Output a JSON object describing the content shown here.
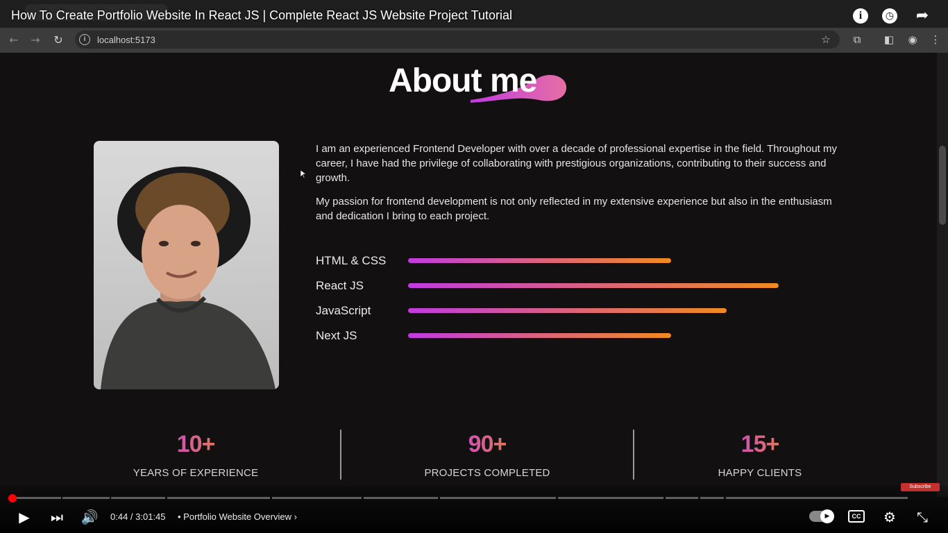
{
  "video": {
    "title": "How To Create Portfolio Website In React JS | Complete React JS Website Project Tutorial",
    "time": "0:44 / 3:01:45",
    "chapter": "• Portfolio Website Overview",
    "progress_fraction": 0.004,
    "subscribe_label": "Subscribe"
  },
  "browser": {
    "url": "localhost:5173"
  },
  "page": {
    "heading": "About me",
    "bio_paragraphs": [
      "I am an experienced Frontend Developer with over a decade of professional expertise in the field. Throughout my career, I have had the privilege of collaborating with prestigious organizations, contributing to their success and growth.",
      "My passion for frontend development is not only reflected in my extensive experience but also in the enthusiasm and dedication I bring to each project."
    ],
    "skills": [
      {
        "name": "HTML & CSS",
        "level": 0.71
      },
      {
        "name": "React JS",
        "level": 1.0
      },
      {
        "name": "JavaScript",
        "level": 0.86
      },
      {
        "name": "Next JS",
        "level": 0.71
      }
    ],
    "stats": [
      {
        "value": "10+",
        "label": "YEARS OF EXPERIENCE"
      },
      {
        "value": "90+",
        "label": "PROJECTS COMPLETED"
      },
      {
        "value": "15+",
        "label": "HAPPY CLIENTS"
      }
    ]
  },
  "icons": {
    "back": "arrow-left-icon",
    "forward": "arrow-right-icon",
    "reload": "reload-icon",
    "star": "star-icon",
    "extensions": "puzzle-icon",
    "sidepanel": "side-panel-icon",
    "profile": "profile-icon",
    "info": "info-icon",
    "watch_later": "clock-icon",
    "share": "share-icon"
  },
  "colors": {
    "accent_start": "#c13be0",
    "accent_end": "#f08a1e",
    "background": "#121010"
  }
}
